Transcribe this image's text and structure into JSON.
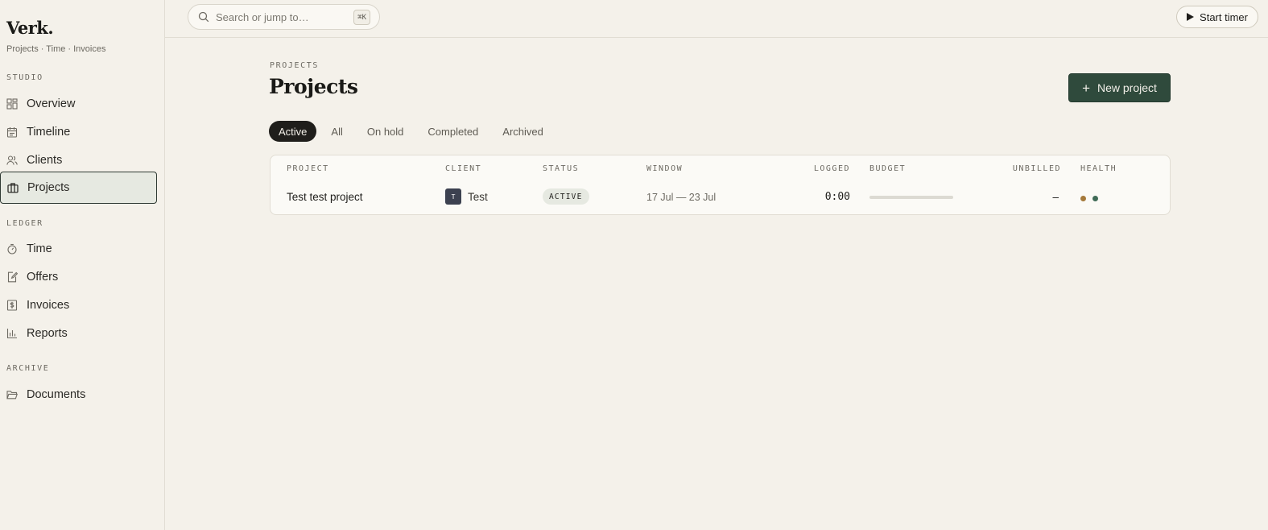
{
  "sidebar": {
    "brand": "Verk.",
    "tagline": "Projects · Time · Invoices",
    "sections": [
      {
        "label": "STUDIO"
      },
      {
        "label": "LEDGER"
      },
      {
        "label": "ARCHIVE"
      }
    ],
    "items": [
      {
        "label": "Overview",
        "icon": "grid-icon"
      },
      {
        "label": "Timeline",
        "icon": "calendar-icon"
      },
      {
        "label": "Clients",
        "icon": "users-icon"
      },
      {
        "label": "Projects",
        "icon": "briefcase-icon",
        "active": true
      },
      {
        "label": "Time",
        "icon": "stopwatch-icon"
      },
      {
        "label": "Offers",
        "icon": "edit-document-icon"
      },
      {
        "label": "Invoices",
        "icon": "dollar-receipt-icon"
      },
      {
        "label": "Reports",
        "icon": "bar-chart-icon"
      },
      {
        "label": "Documents",
        "icon": "folder-icon"
      }
    ]
  },
  "topbar": {
    "search_placeholder": "Search or jump to…",
    "shortcut": "⌘K",
    "start_timer": "Start timer"
  },
  "main": {
    "eyebrow": "PROJECTS",
    "title": "Projects",
    "new_project": "New project",
    "tabs": [
      {
        "label": "Active",
        "active": true
      },
      {
        "label": "All"
      },
      {
        "label": "On hold"
      },
      {
        "label": "Completed"
      },
      {
        "label": "Archived"
      }
    ],
    "table": {
      "headers": [
        "PROJECT",
        "CLIENT",
        "STATUS",
        "WINDOW",
        "LOGGED",
        "BUDGET",
        "UNBILLED",
        "HEALTH"
      ],
      "rows": [
        {
          "project": "Test test project",
          "client_initial": "T",
          "client": "Test",
          "status": "ACTIVE",
          "window": "17 Jul — 23 Jul",
          "logged": "0:00",
          "budget_fraction": 0,
          "unbilled": "–",
          "health": [
            "#a5793a",
            "#3f6b56"
          ]
        }
      ]
    }
  },
  "colors": {
    "accent": "#2f4a3c",
    "background": "#f4f1ea",
    "active_tab": "#1f1e1b"
  }
}
